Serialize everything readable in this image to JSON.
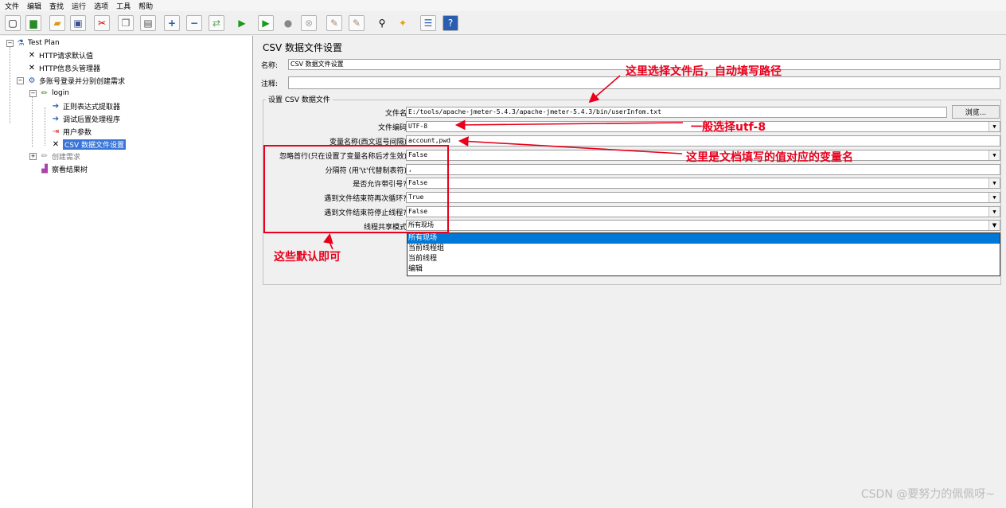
{
  "menu": [
    "文件",
    "编辑",
    "查找",
    "运行",
    "选项",
    "工具",
    "帮助"
  ],
  "toolbar_icons": [
    "new-icon",
    "templates-icon",
    "open-icon",
    "save-icon",
    "cut-icon",
    "copy-icon",
    "paste-icon",
    "expand-icon",
    "collapse-icon",
    "toggle-icon",
    "start-icon",
    "start-no-pause-icon",
    "stop-icon",
    "shutdown-icon",
    "clear-icon",
    "clear-all-icon",
    "search-icon",
    "reset-search-icon",
    "function-helper-icon",
    "help-icon"
  ],
  "tree": {
    "root": "Test Plan",
    "items": [
      {
        "label": "HTTP请求默认值",
        "icon": "wrench-icon"
      },
      {
        "label": "HTTP信息头管理器",
        "icon": "wrench-icon"
      },
      {
        "label": "多账号登录并分别创建需求",
        "icon": "gear-icon"
      },
      {
        "label": "login",
        "icon": "sampler-icon"
      },
      {
        "label": "正则表达式提取器",
        "icon": "extractor-icon"
      },
      {
        "label": "调试后置处理程序",
        "icon": "extractor-icon"
      },
      {
        "label": "用户参数",
        "icon": "preprocessor-icon"
      },
      {
        "label": "CSV 数据文件设置",
        "icon": "wrench-icon"
      },
      {
        "label": "创建需求",
        "icon": "sampler-icon"
      },
      {
        "label": "察看结果树",
        "icon": "listener-icon"
      }
    ]
  },
  "panel": {
    "title": "CSV 数据文件设置",
    "name_label": "名称:",
    "name_value": "CSV 数据文件设置",
    "comment_label": "注释:",
    "comment_value": "",
    "group_title": "设置 CSV 数据文件",
    "filename_label": "文件名:",
    "filename_value": "E:/tools/apache-jmeter-5.4.3/apache-jmeter-5.4.3/bin/userInfom.txt",
    "browse_label": "浏览...",
    "encoding_label": "文件编码:",
    "encoding_value": "UTF-8",
    "varnames_label": "变量名称(西文逗号间隔):",
    "varnames_value": "account,pwd",
    "ignore_first_label": "忽略首行(只在设置了变量名称后才生效):",
    "ignore_first_value": "False",
    "delimiter_label": "分隔符 (用'\\t'代替制表符):",
    "delimiter_value": ",",
    "quoted_label": "是否允许带引号?:",
    "quoted_value": "False",
    "recycle_label": "遇到文件结束符再次循环?:",
    "recycle_value": "True",
    "stop_label": "遇到文件结束符停止线程?:",
    "stop_value": "False",
    "share_label": "线程共享模式:",
    "share_value": "所有现场",
    "share_options": [
      "所有现场",
      "当前线程组",
      "当前线程",
      "编辑"
    ]
  },
  "annotations": {
    "path": "这里选择文件后，自动填写路径",
    "encoding": "一般选择utf-8",
    "varname": "这里是文档填写的值对应的变量名",
    "defaults": "这些默认即可"
  },
  "watermark": "CSDN @要努力的佩佩呀~",
  "colors": {
    "annotation": "#e8001c",
    "selection": "#3875d7",
    "dropdown_highlight": "#0078d7"
  }
}
